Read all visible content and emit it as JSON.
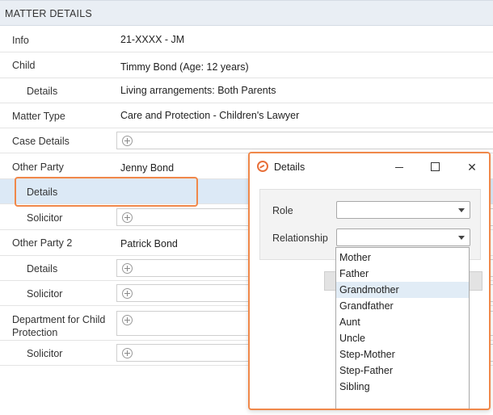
{
  "header": {
    "title": "MATTER DETAILS"
  },
  "rows": {
    "info": {
      "label": "Info",
      "value": "21-XXXX - JM"
    },
    "child": {
      "label": "Child",
      "value": "Timmy Bond (Age: 12 years)"
    },
    "child_details": {
      "label": "Details",
      "value": "Living arrangements: Both Parents"
    },
    "matter_type": {
      "label": "Matter Type",
      "value": "Care and Protection - Children's Lawyer"
    },
    "case_details": {
      "label": "Case Details"
    },
    "other_party": {
      "label": "Other Party",
      "value": "Jenny Bond"
    },
    "other_party_details": {
      "label": "Details"
    },
    "other_party_solicitor": {
      "label": "Solicitor"
    },
    "other_party_2": {
      "label": "Other Party 2",
      "value": "Patrick Bond"
    },
    "other_party_2_details": {
      "label": "Details"
    },
    "other_party_2_solicitor": {
      "label": "Solicitor"
    },
    "department": {
      "label": "Department for Child Protection"
    },
    "department_solicitor": {
      "label": "Solicitor"
    }
  },
  "dialog": {
    "title": "Details",
    "close_glyph": "✕",
    "role_label": "Role",
    "role_value": "",
    "relationship_label": "Relationship",
    "relationship_value": "",
    "options": [
      "Mother",
      "Father",
      "Grandmother",
      "Grandfather",
      "Aunt",
      "Uncle",
      "Step-Mother",
      "Step-Father",
      "Sibling"
    ],
    "hovered_option": "Grandmother"
  },
  "colors": {
    "accent": "#f0884a",
    "header_bg": "#e9eef4",
    "selected_row": "#dce9f6",
    "hover_option": "#e1ecf6"
  }
}
